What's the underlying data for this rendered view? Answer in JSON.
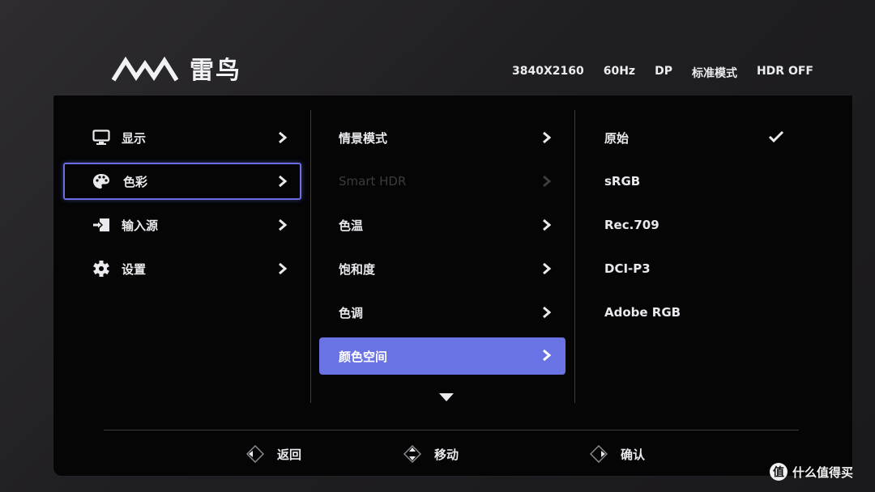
{
  "brand": {
    "name": "雷鸟"
  },
  "status": {
    "resolution": "3840X2160",
    "refresh": "60Hz",
    "input": "DP",
    "mode": "标准模式",
    "hdr": "HDR OFF"
  },
  "main_menu": {
    "items": [
      {
        "label": "显示",
        "icon": "monitor-icon"
      },
      {
        "label": "色彩",
        "icon": "palette-icon",
        "selected": true
      },
      {
        "label": "输入源",
        "icon": "input-source-icon"
      },
      {
        "label": "设置",
        "icon": "gear-icon"
      }
    ]
  },
  "sub_menu": {
    "items": [
      {
        "label": "情景模式"
      },
      {
        "label": "Smart HDR",
        "disabled": true
      },
      {
        "label": "色温"
      },
      {
        "label": "饱和度"
      },
      {
        "label": "色调"
      },
      {
        "label": "颜色空间",
        "highlighted": true
      }
    ]
  },
  "options": {
    "items": [
      {
        "label": "原始",
        "checked": true
      },
      {
        "label": "sRGB"
      },
      {
        "label": "Rec.709"
      },
      {
        "label": "DCI-P3"
      },
      {
        "label": "Adobe RGB"
      }
    ]
  },
  "footer": {
    "back": "返回",
    "move": "移动",
    "confirm": "确认"
  },
  "watermark": {
    "badge": "值",
    "text": "什么值得买"
  },
  "colors": {
    "highlight": "#6a73e3",
    "outline": "#6a6ee0",
    "panel": "#050506",
    "text": "#e9e9ee",
    "disabled": "#3b3b40"
  }
}
